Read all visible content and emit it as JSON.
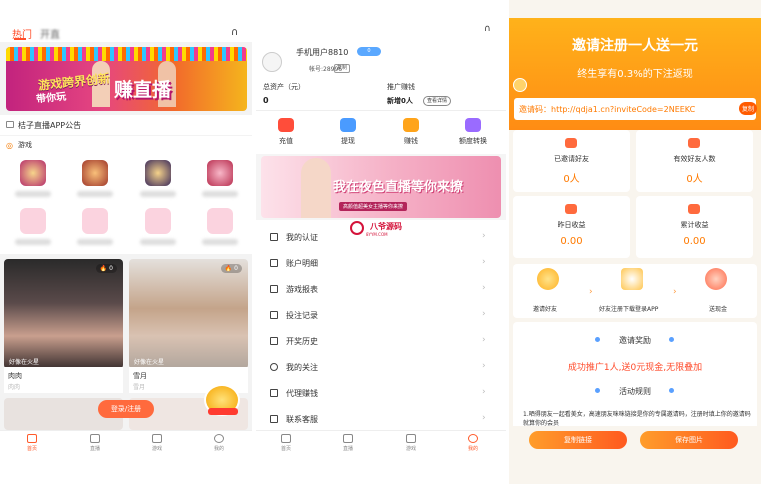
{
  "home": {
    "tab_hot": "热门",
    "tab_other": "开直",
    "banner": {
      "slogan": "游戏跨界创新",
      "slogan2": "带你玩",
      "big": "赚直播"
    },
    "notice": "桔子直播APP公告",
    "games_title": "游戏",
    "cards": [
      {
        "caption": "好像在火星",
        "name": "肉肉",
        "sub": "肉肉",
        "views": "0"
      },
      {
        "caption": "好像在火星",
        "name": "雪月",
        "sub": "雪月",
        "views": "0"
      }
    ],
    "login_label": "登录/注册",
    "tabbar": [
      {
        "label": "首页",
        "icon": "home-icon",
        "active": true
      },
      {
        "label": "直播",
        "icon": "video-icon",
        "active": false
      },
      {
        "label": "游戏",
        "icon": "gamepad-icon",
        "active": false
      },
      {
        "label": "我的",
        "icon": "user-icon",
        "active": false
      }
    ]
  },
  "profile": {
    "username": "手机用户8810",
    "vip_badge": "0",
    "uid_text": "帐号:28996",
    "copy_label": "复制",
    "assets_label": "总资产（元）",
    "assets_value": "0",
    "promo_label": "推广赚钱",
    "new_added": "新增0人",
    "detail_label": "查看详情",
    "grid": [
      {
        "label": "充值",
        "icon": "wallet-icon",
        "color": "#ff4d3a"
      },
      {
        "label": "提现",
        "icon": "card-icon",
        "color": "#4a9bff"
      },
      {
        "label": "赚钱",
        "icon": "money-icon",
        "color": "#ffa41a"
      },
      {
        "label": "额度转换",
        "icon": "exchange-icon",
        "color": "#9a6bff"
      }
    ],
    "banner_text": "我在夜色直播等你来撩",
    "banner_sub": "高颜值超美女主播等你来撩",
    "watermark": {
      "text": "八爷源码",
      "sub": "8YYM.COM"
    },
    "menu": [
      "我的认证",
      "账户明细",
      "游戏报表",
      "投注记录",
      "开奖历史",
      "我的关注",
      "代理赚钱",
      "联系客服"
    ],
    "tabbar": [
      {
        "label": "首页",
        "active": false
      },
      {
        "label": "直播",
        "active": false
      },
      {
        "label": "游戏",
        "active": false
      },
      {
        "label": "我的",
        "active": true
      }
    ]
  },
  "invite": {
    "title": "邀请注册一人送一元",
    "subtitle": "终生享有0.3%的下注返现",
    "code_text": "邀请码：http://qdja1.cn?inviteCode=2NEEKC",
    "copy_small": "复制",
    "stats": [
      {
        "label": "已邀请好友",
        "value": "0人"
      },
      {
        "label": "有效好友人数",
        "value": "0人"
      },
      {
        "label": "昨日收益",
        "value": "0.00"
      },
      {
        "label": "累计收益",
        "value": "0.00"
      }
    ],
    "steps": [
      "邀请好友",
      "好友注册下载登录APP",
      "送现金"
    ],
    "reward_title": "邀请奖励",
    "promo": "成功推广1人,送0元现金,无限叠加",
    "rules_title": "活动规则",
    "rule_text": "1.晒得朋友一起看美女，高速朋友咪咪链接是你的专属邀请码，注册时填上你的邀请码就算你的会员",
    "btn_copy": "复制链接",
    "btn_save": "保存图片"
  }
}
